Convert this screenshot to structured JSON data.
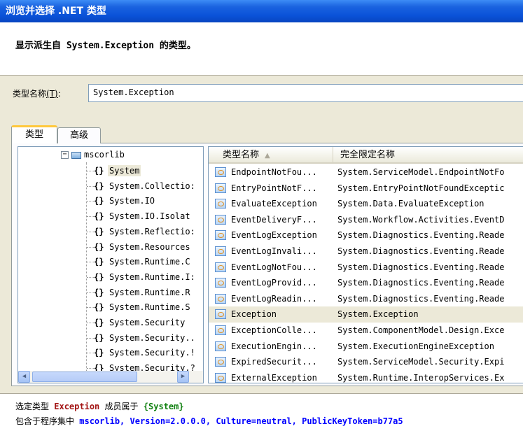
{
  "window": {
    "title": "浏览并选择 .NET 类型"
  },
  "header": {
    "text": "显示派生自 System.Exception 的类型。"
  },
  "type_name": {
    "label": "类型名称",
    "accel": "(T)",
    "colon": ":",
    "value": "System.Exception"
  },
  "tabs": [
    {
      "label": "类型"
    },
    {
      "label": "高级"
    }
  ],
  "tree": {
    "root": "mscorlib",
    "namespaces": [
      "System",
      "System.Collectio:",
      "System.IO",
      "System.IO.Isolat",
      "System.Reflectio:",
      "System.Resources",
      "System.Runtime.C",
      "System.Runtime.I:",
      "System.Runtime.R",
      "System.Runtime.S",
      "System.Security",
      "System.Security..",
      "System.Security.!",
      "System.Security.?"
    ],
    "selected_index": 0
  },
  "list": {
    "columns": {
      "name": "类型名称",
      "full": "完全限定名称"
    },
    "rows": [
      {
        "name": "EndpointNotFou...",
        "full": "System.ServiceModel.EndpointNotFo"
      },
      {
        "name": "EntryPointNotF...",
        "full": "System.EntryPointNotFoundExceptic"
      },
      {
        "name": "EvaluateException",
        "full": "System.Data.EvaluateException"
      },
      {
        "name": "EventDeliveryF...",
        "full": "System.Workflow.Activities.EventD"
      },
      {
        "name": "EventLogException",
        "full": "System.Diagnostics.Eventing.Reade"
      },
      {
        "name": "EventLogInvali...",
        "full": "System.Diagnostics.Eventing.Reade"
      },
      {
        "name": "EventLogNotFou...",
        "full": "System.Diagnostics.Eventing.Reade"
      },
      {
        "name": "EventLogProvid...",
        "full": "System.Diagnostics.Eventing.Reade"
      },
      {
        "name": "EventLogReadin...",
        "full": "System.Diagnostics.Eventing.Reade"
      },
      {
        "name": "Exception",
        "full": "System.Exception"
      },
      {
        "name": "ExceptionColle...",
        "full": "System.ComponentModel.Design.Exce"
      },
      {
        "name": "ExecutionEngin...",
        "full": "System.ExecutionEngineException"
      },
      {
        "name": "ExpiredSecurit...",
        "full": "System.ServiceModel.Security.Expi"
      },
      {
        "name": "ExternalException",
        "full": "System.Runtime.InteropServices.Ex"
      }
    ],
    "selected_index": 9
  },
  "description": {
    "line1_prefix": "选定类型",
    "type_name": "Exception",
    "line1_mid": "成员属于",
    "namespace": "{System}",
    "line2_prefix": "包含于程序集中",
    "assembly": "mscorlib, Version=2.0.0.0, Culture=neutral, PublicKeyToken=b77a5"
  },
  "icons": {
    "namespace": "{}",
    "sort": "▲",
    "scroll_up": "▲",
    "scroll_down": "▼",
    "scroll_left": "◀",
    "scroll_right": "▶"
  }
}
